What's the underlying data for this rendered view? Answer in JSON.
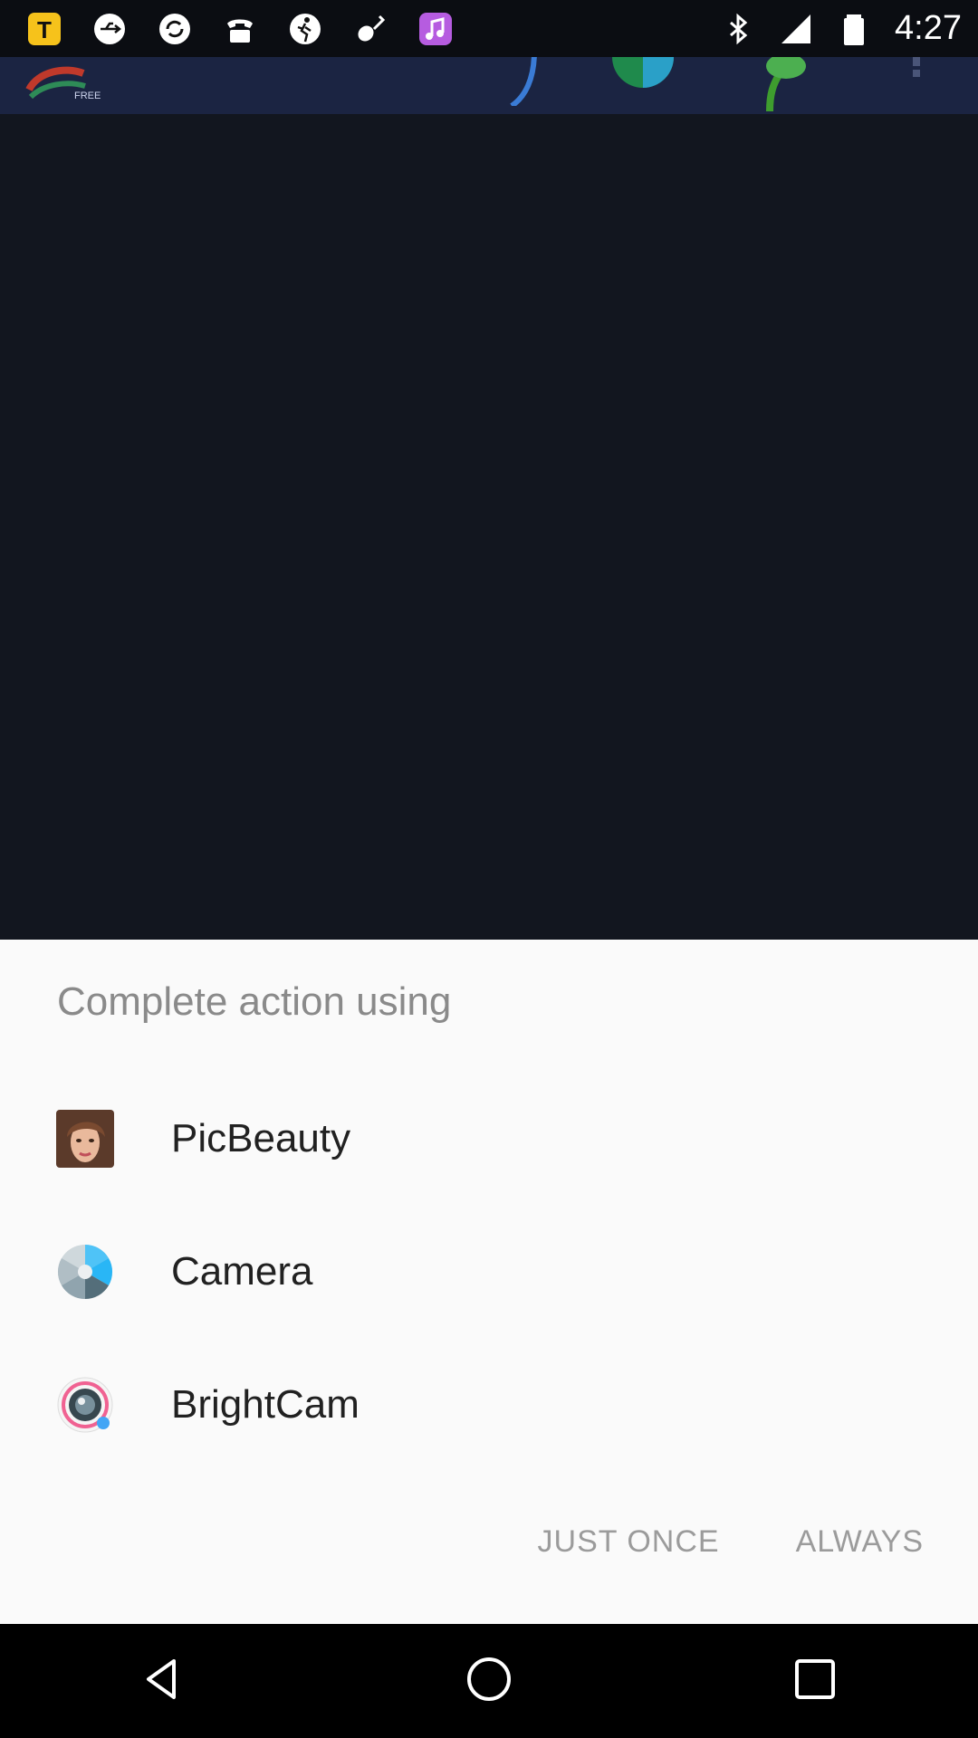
{
  "status_bar": {
    "time": "4:27",
    "left_icons": [
      "tubemate-icon",
      "usb-icon",
      "sync-icon",
      "phone-icon",
      "pedestrian-icon",
      "violin-icon",
      "music-icon"
    ],
    "right_icons": [
      "bluetooth-icon",
      "signal-icon",
      "battery-icon"
    ]
  },
  "background_app": {
    "logo_badge": "FREE"
  },
  "sheet": {
    "title": "Complete action using",
    "apps": [
      {
        "label": "PicBeauty",
        "icon": "picbeauty-icon"
      },
      {
        "label": "Camera",
        "icon": "camera-icon"
      },
      {
        "label": "BrightCam",
        "icon": "brightcam-icon"
      }
    ],
    "just_once_label": "JUST ONCE",
    "always_label": "ALWAYS"
  },
  "nav_bar": {
    "icons": [
      "back-icon",
      "home-icon",
      "recents-icon"
    ]
  },
  "colors": {
    "sheet_bg": "#fafafa",
    "title": "#8a8a8a",
    "label": "#212121",
    "button_text": "#9b9b9b",
    "scrim": "#12161f"
  }
}
